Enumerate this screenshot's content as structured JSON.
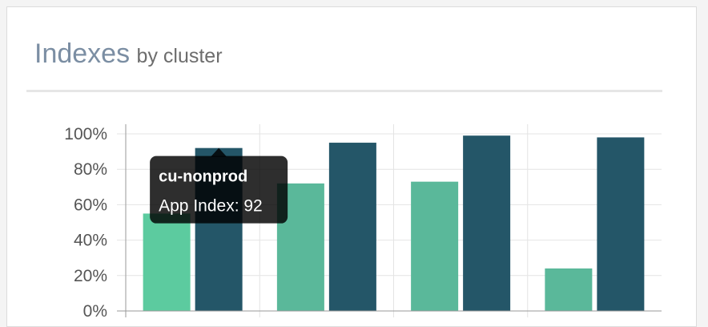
{
  "panel": {
    "title": "Indexes",
    "subtitle": "by cluster"
  },
  "chart_data": {
    "type": "bar",
    "categories": [
      "cu-nonprod",
      "",
      "",
      ""
    ],
    "ylim": [
      0,
      100
    ],
    "yticks": [
      "0%",
      "20%",
      "40%",
      "60%",
      "80%",
      "100%"
    ],
    "grid": true,
    "series": [
      {
        "name": "",
        "colors": [
          "#5ccb9f",
          "#5ab89a",
          "#5ab89a",
          "#5ab89a"
        ],
        "values": [
          55,
          72,
          73,
          24
        ]
      },
      {
        "name": "App Index",
        "colors": [
          "#245668",
          "#245668",
          "#245668",
          "#245668"
        ],
        "values": [
          92,
          95,
          99,
          98
        ]
      }
    ]
  },
  "tooltip": {
    "title": "cu-nonprod",
    "body": "App Index: 92"
  }
}
